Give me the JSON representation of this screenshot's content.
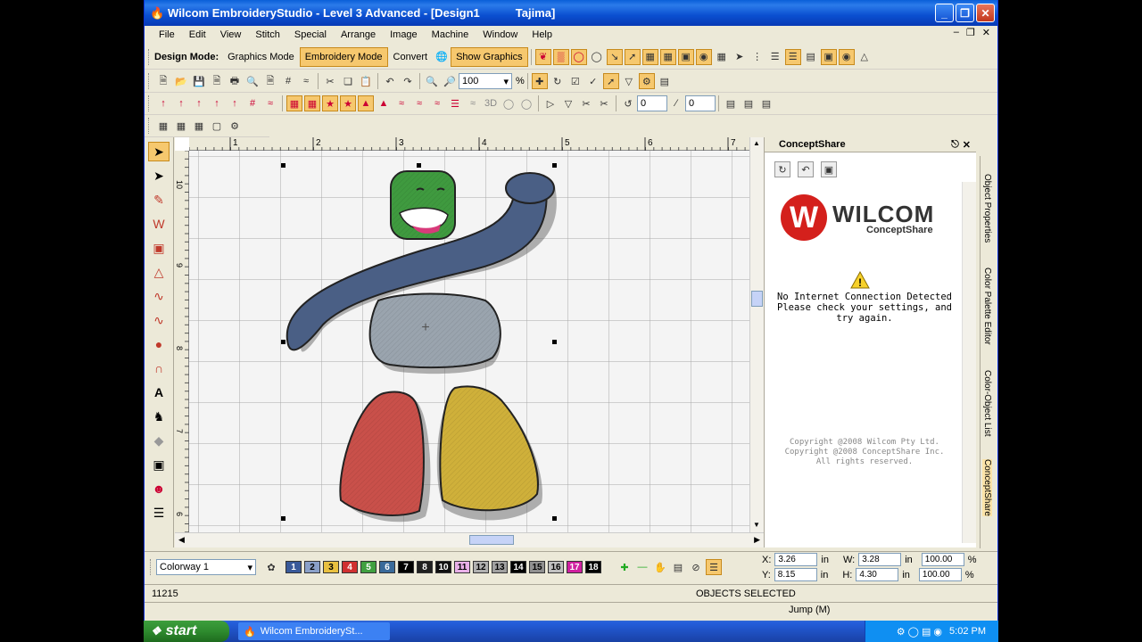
{
  "window": {
    "title": "Wilcom EmbroideryStudio - Level 3 Advanced - [Design1",
    "title_suffix": "Tajima]"
  },
  "menu": [
    "File",
    "Edit",
    "View",
    "Stitch",
    "Special",
    "Arrange",
    "Image",
    "Machine",
    "Window",
    "Help"
  ],
  "toolbar": {
    "design_mode_label": "Design Mode:",
    "graphics_mode": "Graphics Mode",
    "embroidery_mode": "Embroidery Mode",
    "convert": "Convert",
    "show_graphics": "Show Graphics",
    "zoom_value": "100",
    "zoom_unit": "%",
    "angle1": "0",
    "angle2": "0",
    "font_3d": "3D"
  },
  "ruler": {
    "top": [
      "1",
      "2",
      "3",
      "4",
      "5",
      "6",
      "7"
    ],
    "left": [
      "10",
      "9",
      "8",
      "7",
      "6"
    ]
  },
  "panel": {
    "title": "ConceptShare",
    "logo_main": "WILCOM",
    "logo_sub": "ConceptShare",
    "warning_line1": "No Internet Connection Detected",
    "warning_line2": "Please check your settings, and try again.",
    "copyright1": "Copyright @2008 Wilcom Pty Ltd.",
    "copyright2": "Copyright @2008 ConceptShare Inc.",
    "copyright3": "All rights reserved."
  },
  "side_tabs": [
    "Object Properties",
    "Color Palette Editor",
    "Color-Object List",
    "ConceptShare"
  ],
  "colorway": {
    "selected": "Colorway 1",
    "swatches": [
      {
        "n": "1",
        "c": "#3a5a9a"
      },
      {
        "n": "2",
        "c": "#8aa0c8"
      },
      {
        "n": "3",
        "c": "#e8c040"
      },
      {
        "n": "4",
        "c": "#d03030"
      },
      {
        "n": "5",
        "c": "#40a040"
      },
      {
        "n": "6",
        "c": "#3a6a9a"
      },
      {
        "n": "7",
        "c": "#000000"
      },
      {
        "n": "8",
        "c": "#202020"
      },
      {
        "n": "10",
        "c": "#101010"
      },
      {
        "n": "11",
        "c": "#e8b0e8"
      },
      {
        "n": "12",
        "c": "#b0b0b0"
      },
      {
        "n": "13",
        "c": "#a0a0a0"
      },
      {
        "n": "14",
        "c": "#000000"
      },
      {
        "n": "15",
        "c": "#909090"
      },
      {
        "n": "16",
        "c": "#c0c0c0"
      },
      {
        "n": "17",
        "c": "#d020a0"
      },
      {
        "n": "18",
        "c": "#000000"
      }
    ]
  },
  "coords": {
    "x_label": "X:",
    "x": "3.26",
    "y_label": "Y:",
    "y": "8.15",
    "w_label": "W:",
    "w": "3.28",
    "h_label": "H:",
    "h": "4.30",
    "unit": "in",
    "pw": "100.00",
    "ph": "100.00",
    "pct": "%"
  },
  "status": {
    "stitch_count": "11215",
    "objects_selected": "OBJECTS SELECTED",
    "jump": "Jump (M)"
  },
  "taskbar": {
    "start": "start",
    "task": "Wilcom EmbroiderySt...",
    "clock": "5:02 PM"
  }
}
